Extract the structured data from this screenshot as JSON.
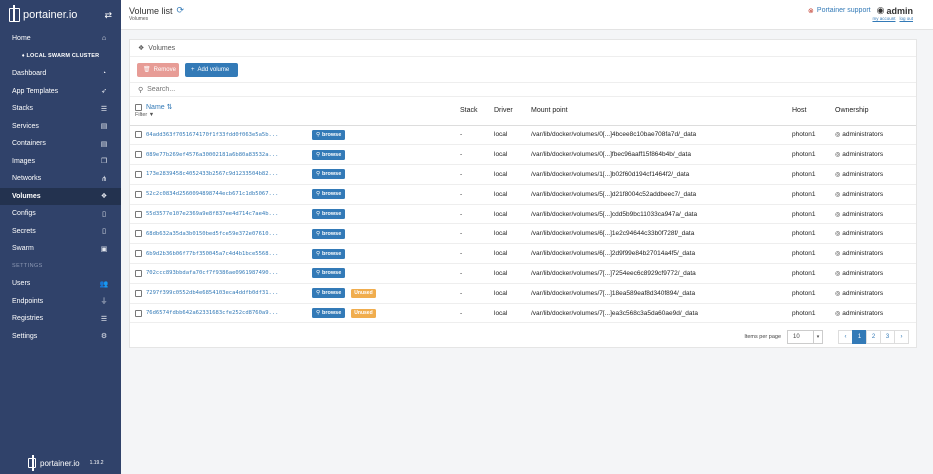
{
  "app": {
    "brand": "portainer.io",
    "version": "1.19.2",
    "cluster": "LOCAL SWARM CLUSTER"
  },
  "sidebar": {
    "items": [
      {
        "label": "Home",
        "icon": "home-icon",
        "glyph": "⌂"
      },
      {
        "label": "Dashboard",
        "icon": "tachometer-icon",
        "glyph": "◔"
      },
      {
        "label": "App Templates",
        "icon": "rocket-icon",
        "glyph": "➶"
      },
      {
        "label": "Stacks",
        "icon": "list-icon",
        "glyph": "☰"
      },
      {
        "label": "Services",
        "icon": "list-alt-icon",
        "glyph": "▤"
      },
      {
        "label": "Containers",
        "icon": "server-icon",
        "glyph": "▤"
      },
      {
        "label": "Images",
        "icon": "clone-icon",
        "glyph": "❐"
      },
      {
        "label": "Networks",
        "icon": "sitemap-icon",
        "glyph": "⋔"
      },
      {
        "label": "Volumes",
        "icon": "cubes-icon",
        "glyph": "❖"
      },
      {
        "label": "Configs",
        "icon": "file-code-icon",
        "glyph": "▯"
      },
      {
        "label": "Secrets",
        "icon": "user-secret-icon",
        "glyph": "▯"
      },
      {
        "label": "Swarm",
        "icon": "object-group-icon",
        "glyph": "▣"
      }
    ],
    "section_label": "SETTINGS",
    "settings_items": [
      {
        "label": "Users",
        "icon": "users-icon",
        "glyph": "👥"
      },
      {
        "label": "Endpoints",
        "icon": "plug-icon",
        "glyph": "⏚"
      },
      {
        "label": "Registries",
        "icon": "database-icon",
        "glyph": "☰"
      },
      {
        "label": "Settings",
        "icon": "cogs-icon",
        "glyph": "⚙"
      }
    ]
  },
  "header": {
    "title": "Volume list",
    "breadcrumb": "Volumes",
    "support": "Portainer support",
    "user": "admin",
    "my_account": "my account",
    "log_out": "log out"
  },
  "panel": {
    "title": "Volumes",
    "remove_label": "Remove",
    "add_label": "Add volume",
    "search_placeholder": "Search..."
  },
  "table": {
    "columns": {
      "name": "Name",
      "filter": "Filter",
      "stack": "Stack",
      "driver": "Driver",
      "mount": "Mount point",
      "host": "Host",
      "ownership": "Ownership"
    },
    "browse_label": "browse",
    "unused_label": "Unused",
    "rows": [
      {
        "name": "04add363f7051674170f1f33fdd0f063e5a5b...",
        "stack": "-",
        "driver": "local",
        "mount": "/var/lib/docker/volumes/0[...]4bcee8c10bae708fa7d/_data",
        "host": "photon1",
        "ownership": "administrators",
        "unused": false
      },
      {
        "name": "089e77b269ef4576a30002181a6b80a83532a...",
        "stack": "-",
        "driver": "local",
        "mount": "/var/lib/docker/volumes/0[...]fbec96aaff15f864b4b/_data",
        "host": "photon1",
        "ownership": "administrators",
        "unused": false
      },
      {
        "name": "173e2839458c4052433b2567c9d1233504b82...",
        "stack": "-",
        "driver": "local",
        "mount": "/var/lib/docker/volumes/1[...]b02f60d194cf1464f2/_data",
        "host": "photon1",
        "ownership": "administrators",
        "unused": false
      },
      {
        "name": "52c2c0834d2560094898744ecb671c1db5067...",
        "stack": "-",
        "driver": "local",
        "mount": "/var/lib/docker/volumes/5[...]d21f8004c52addbeec7/_data",
        "host": "photon1",
        "ownership": "administrators",
        "unused": false
      },
      {
        "name": "55d3577e107e2369a9e8f837ee4d714c7ae4b...",
        "stack": "-",
        "driver": "local",
        "mount": "/var/lib/docker/volumes/5[...]cdd5b9bc11033ca947a/_data",
        "host": "photon1",
        "ownership": "administrators",
        "unused": false
      },
      {
        "name": "68db632a35da3b0150bed5fce59e372e07610...",
        "stack": "-",
        "driver": "local",
        "mount": "/var/lib/docker/volumes/6[...]1e2c94644c33b0f728f/_data",
        "host": "photon1",
        "ownership": "administrators",
        "unused": false
      },
      {
        "name": "6b9d2b36b06f77bf350045a7c4d4b1bce5568...",
        "stack": "-",
        "driver": "local",
        "mount": "/var/lib/docker/volumes/6[...]2d9f99e84b27014a4f5/_data",
        "host": "photon1",
        "ownership": "administrators",
        "unused": false
      },
      {
        "name": "702ccc893bbdafa70cf7f9386ae0961987490...",
        "stack": "-",
        "driver": "local",
        "mount": "/var/lib/docker/volumes/7[...]7254eec6c8929cf9772/_data",
        "host": "photon1",
        "ownership": "administrators",
        "unused": false
      },
      {
        "name": "7297f399c0552db4e6854103eca4ddfb0df31...",
        "stack": "-",
        "driver": "local",
        "mount": "/var/lib/docker/volumes/7[...]18ea589eaf8d340f894/_data",
        "host": "photon1",
        "ownership": "administrators",
        "unused": true
      },
      {
        "name": "76d6574fdbb642a62331683cfe252cd8760a9...",
        "stack": "-",
        "driver": "local",
        "mount": "/var/lib/docker/volumes/7[...]ea3c568c3a5da60ae9d/_data",
        "host": "photon1",
        "ownership": "administrators",
        "unused": true
      }
    ]
  },
  "pagination": {
    "items_per_page_label": "Items per page",
    "per_page_value": "10",
    "prev": "‹",
    "next": "›",
    "pages": [
      "1",
      "2",
      "3"
    ],
    "current": "1"
  },
  "colors": {
    "sidebar": "#30426a",
    "accent": "#337ab7",
    "unused": "#f0ad4e",
    "remove": "#e79c96"
  }
}
